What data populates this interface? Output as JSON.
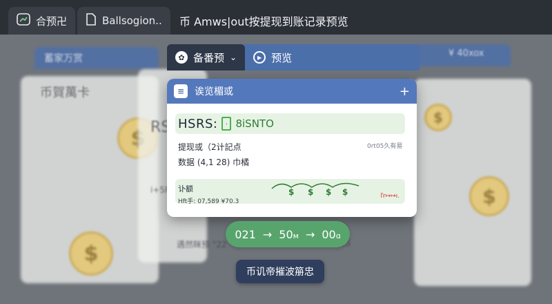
{
  "topbar": {
    "tabs": [
      {
        "label": "合预卍",
        "icon": "chart-icon"
      },
      {
        "label": "Ballsogion..",
        "icon": "document-icon"
      }
    ],
    "title": "币 Amws|out按提现到账记录预览"
  },
  "tabbar2": {
    "tabs": [
      {
        "label": "备番预",
        "icon": "gear-icon",
        "caret": "⌄"
      },
      {
        "label": "预览",
        "icon": "play-icon"
      }
    ]
  },
  "modal": {
    "header_title": "诶览楣或",
    "header_icon": "list-icon",
    "plus": "+",
    "code_label": "HSRS:",
    "code_box": "·",
    "code_value": "8iSNTO",
    "line1": "提现或（2计記点",
    "line1_right": "0rt05久有易",
    "line2": "数据 (4,1 28) 巾橘",
    "amount_label": "讣额",
    "amount_detail": "Hft手: 07,589 ¥70.3",
    "dollars": [
      "$",
      "$",
      "$",
      "$"
    ],
    "red_mark": "ľr↦↦ı."
  },
  "pill": {
    "v1": "021",
    "arrow1": "→",
    "v2": "50",
    "u2": "м",
    "arrow2": "→",
    "v3": "00",
    "u3": "ɑ"
  },
  "dark_button": {
    "label": "币讥帝摧波笧忠"
  },
  "background": {
    "left_tab": "蓄家万赏",
    "left_card_title": "币賀萬卡",
    "rs_label": "RS",
    "right_label": "¥ 40xox",
    "num_label": "i+5F",
    "row_label": "遇然眯预 \"22",
    "x15": "x15"
  }
}
